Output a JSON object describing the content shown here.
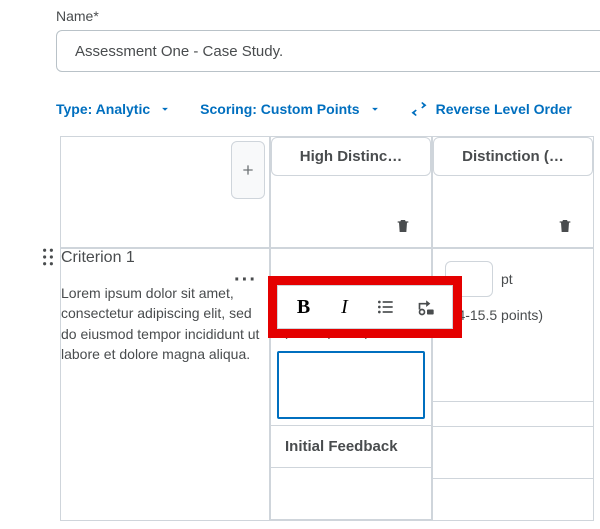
{
  "name_field": {
    "label": "Name*",
    "value": "Assessment One - Case Study."
  },
  "toolbar": {
    "type_label": "Type: Analytic",
    "scoring_label": "Scoring: Custom Points",
    "reverse_label": "Reverse Level Order"
  },
  "levels": [
    {
      "name": "High Distinc…",
      "points_text": "(16-20 points)"
    },
    {
      "name": "Distinction (…",
      "points_text": "(14-15.5 points)"
    }
  ],
  "criterion": {
    "title": "Criterion 1",
    "description": "Lorem ipsum dolor sit amet, consectetur adipiscing elit, sed do eiusmod tempor incididunt ut labore et dolore magna aliqua."
  },
  "points": {
    "col2_value": "",
    "unit": "pt"
  },
  "feedback_header": "Initial Feedback",
  "icons": {
    "bold": "B",
    "italic": "I"
  }
}
